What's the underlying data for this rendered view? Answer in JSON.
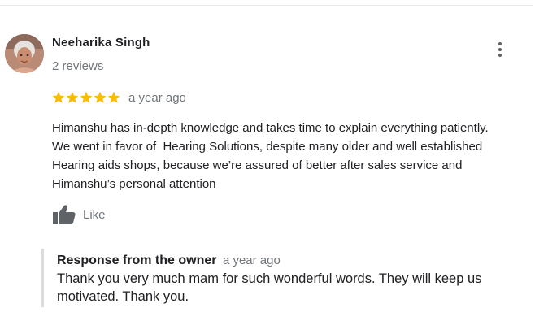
{
  "review": {
    "reviewer_name": "Neeharika Singh",
    "review_count": "2 reviews",
    "rating": 5,
    "rating_max": 5,
    "date": "a year ago",
    "text": "Himanshu has in-depth knowledge and takes time to explain everything patiently.\nWe went in favor of  Hearing Solutions, despite many older and well established\nHearing aids shops, because we’re assured of better after sales service and\nHimanshu’s personal attention",
    "like_label": "Like",
    "more_icon": "more-vert-icon",
    "like_icon": "thumbs-up-icon"
  },
  "owner_response": {
    "title": "Response from the owner",
    "date": "a year ago",
    "text": "Thank you very much mam for such wonderful words. They will keep us motivated. Thank you."
  },
  "colors": {
    "star": "#fbbc04",
    "secondary_text": "#70757a",
    "primary_text": "#202124",
    "response_border": "#dadce0",
    "icon_gray": "#5f6368"
  }
}
